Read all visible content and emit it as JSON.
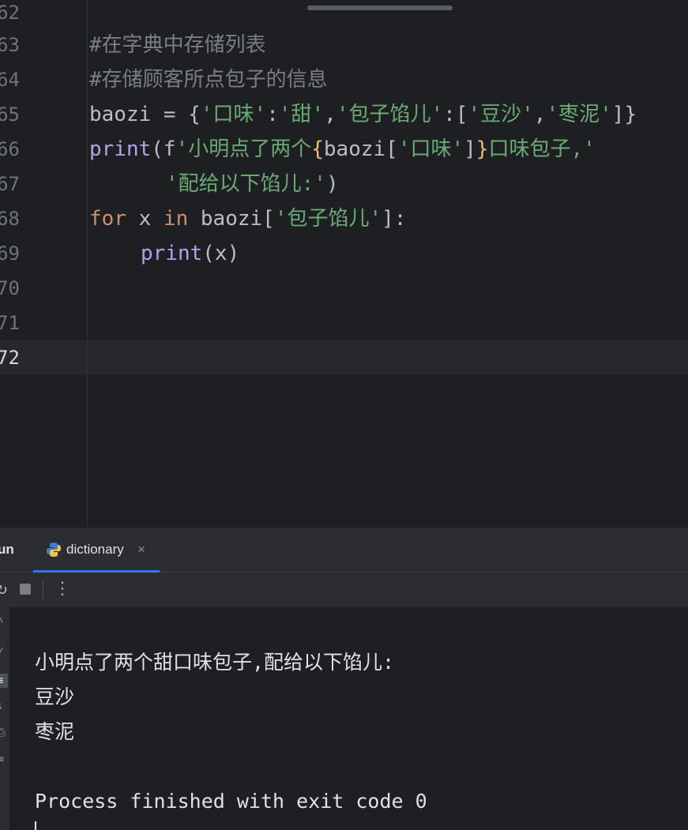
{
  "editor": {
    "lines": [
      {
        "num": "62",
        "text": ""
      },
      {
        "num": "63",
        "text": "#在字典中存储列表"
      },
      {
        "num": "64",
        "text": "#存储顾客所点包子的信息"
      },
      {
        "num": "65",
        "text": "baozi = {'口味':'甜','包子馅儿':['豆沙','枣泥']}"
      },
      {
        "num": "66",
        "text": "print(f'小明点了两个{baozi['口味']}口味包子,'"
      },
      {
        "num": "67",
        "text": "'配给以下馅儿:')"
      },
      {
        "num": "68",
        "text": "for x in baozi['包子馅儿']:"
      },
      {
        "num": "69",
        "text": "print(x)"
      },
      {
        "num": "70",
        "text": ""
      },
      {
        "num": "71",
        "text": ""
      },
      {
        "num": "72",
        "text": ""
      }
    ],
    "tokens": {
      "l65_var": "baozi",
      "l65_eq": " = ",
      "l65_open": "{",
      "l65_str1": "'口味'",
      "l65_colon1": ":",
      "l65_str2": "'甜'",
      "l65_comma1": ",",
      "l65_str3": "'包子馅儿'",
      "l65_colon2": ":[",
      "l65_str4": "'豆沙'",
      "l65_comma2": ",",
      "l65_str5": "'枣泥'",
      "l65_close": "]}",
      "l66_fn": "print",
      "l66_paren": "(f",
      "l66_str1": "'小明点了两个",
      "l66_brace_open": "{",
      "l66_expr": "baozi[",
      "l66_key": "'口味'",
      "l66_expr_close": "]",
      "l66_brace_close": "}",
      "l66_str2": "口味包子,'",
      "l67_str": "'配给以下馅儿:'",
      "l67_close": ")",
      "l68_for": "for",
      "l68_x": " x ",
      "l68_in": "in",
      "l68_rest": " baozi[",
      "l68_key": "'包子馅儿'",
      "l68_end": "]:",
      "l69_fn": "print",
      "l69_args": "(x)"
    }
  },
  "run": {
    "title": "Run",
    "title_visible": "un",
    "tab_label": "dictionary",
    "tab_close": "×",
    "output_lines": [
      "小明点了两个甜口味包子,配给以下馅儿:",
      "豆沙",
      "枣泥",
      "",
      "Process finished with exit code 0"
    ]
  },
  "colors": {
    "background": "#1e1f22",
    "keyword": "#cf8e6d",
    "function": "#b0a3e8",
    "string": "#6aab73",
    "comment": "#7a7e85",
    "accent": "#3574f0"
  },
  "icons": [
    "python-file-icon",
    "rerun-icon",
    "stop-icon",
    "more-options-icon",
    "close-icon"
  ]
}
